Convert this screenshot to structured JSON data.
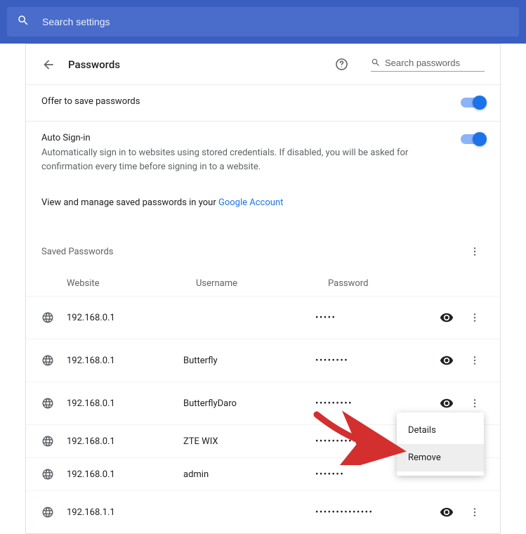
{
  "searchBar": {
    "placeholder": "Search settings"
  },
  "header": {
    "title": "Passwords",
    "searchPlaceholder": "Search passwords"
  },
  "offer": {
    "label": "Offer to save passwords",
    "on": true
  },
  "autoSignIn": {
    "title": "Auto Sign-in",
    "desc": "Automatically sign in to websites using stored credentials. If disabled, you will be asked for confirmation every time before signing in to a website.",
    "on": true
  },
  "accountLink": {
    "prefix": "View and manage saved passwords in your ",
    "link": "Google Account"
  },
  "savedSection": {
    "title": "Saved Passwords"
  },
  "listHeader": {
    "website": "Website",
    "username": "Username",
    "password": "Password"
  },
  "rows": [
    {
      "site": "192.168.0.1",
      "user": "",
      "dots": "•••••"
    },
    {
      "site": "192.168.0.1",
      "user": "Butterfly",
      "dots": "••••••••"
    },
    {
      "site": "192.168.0.1",
      "user": "ButterflyDaro",
      "dots": "•••••••••"
    },
    {
      "site": "192.168.0.1",
      "user": "ZTE WIX",
      "dots": "•••••••••••"
    },
    {
      "site": "192.168.0.1",
      "user": "admin",
      "dots": "•••••••"
    },
    {
      "site": "192.168.1.1",
      "user": "",
      "dots": "••••••••••••••"
    }
  ],
  "contextMenu": {
    "details": "Details",
    "remove": "Remove"
  }
}
